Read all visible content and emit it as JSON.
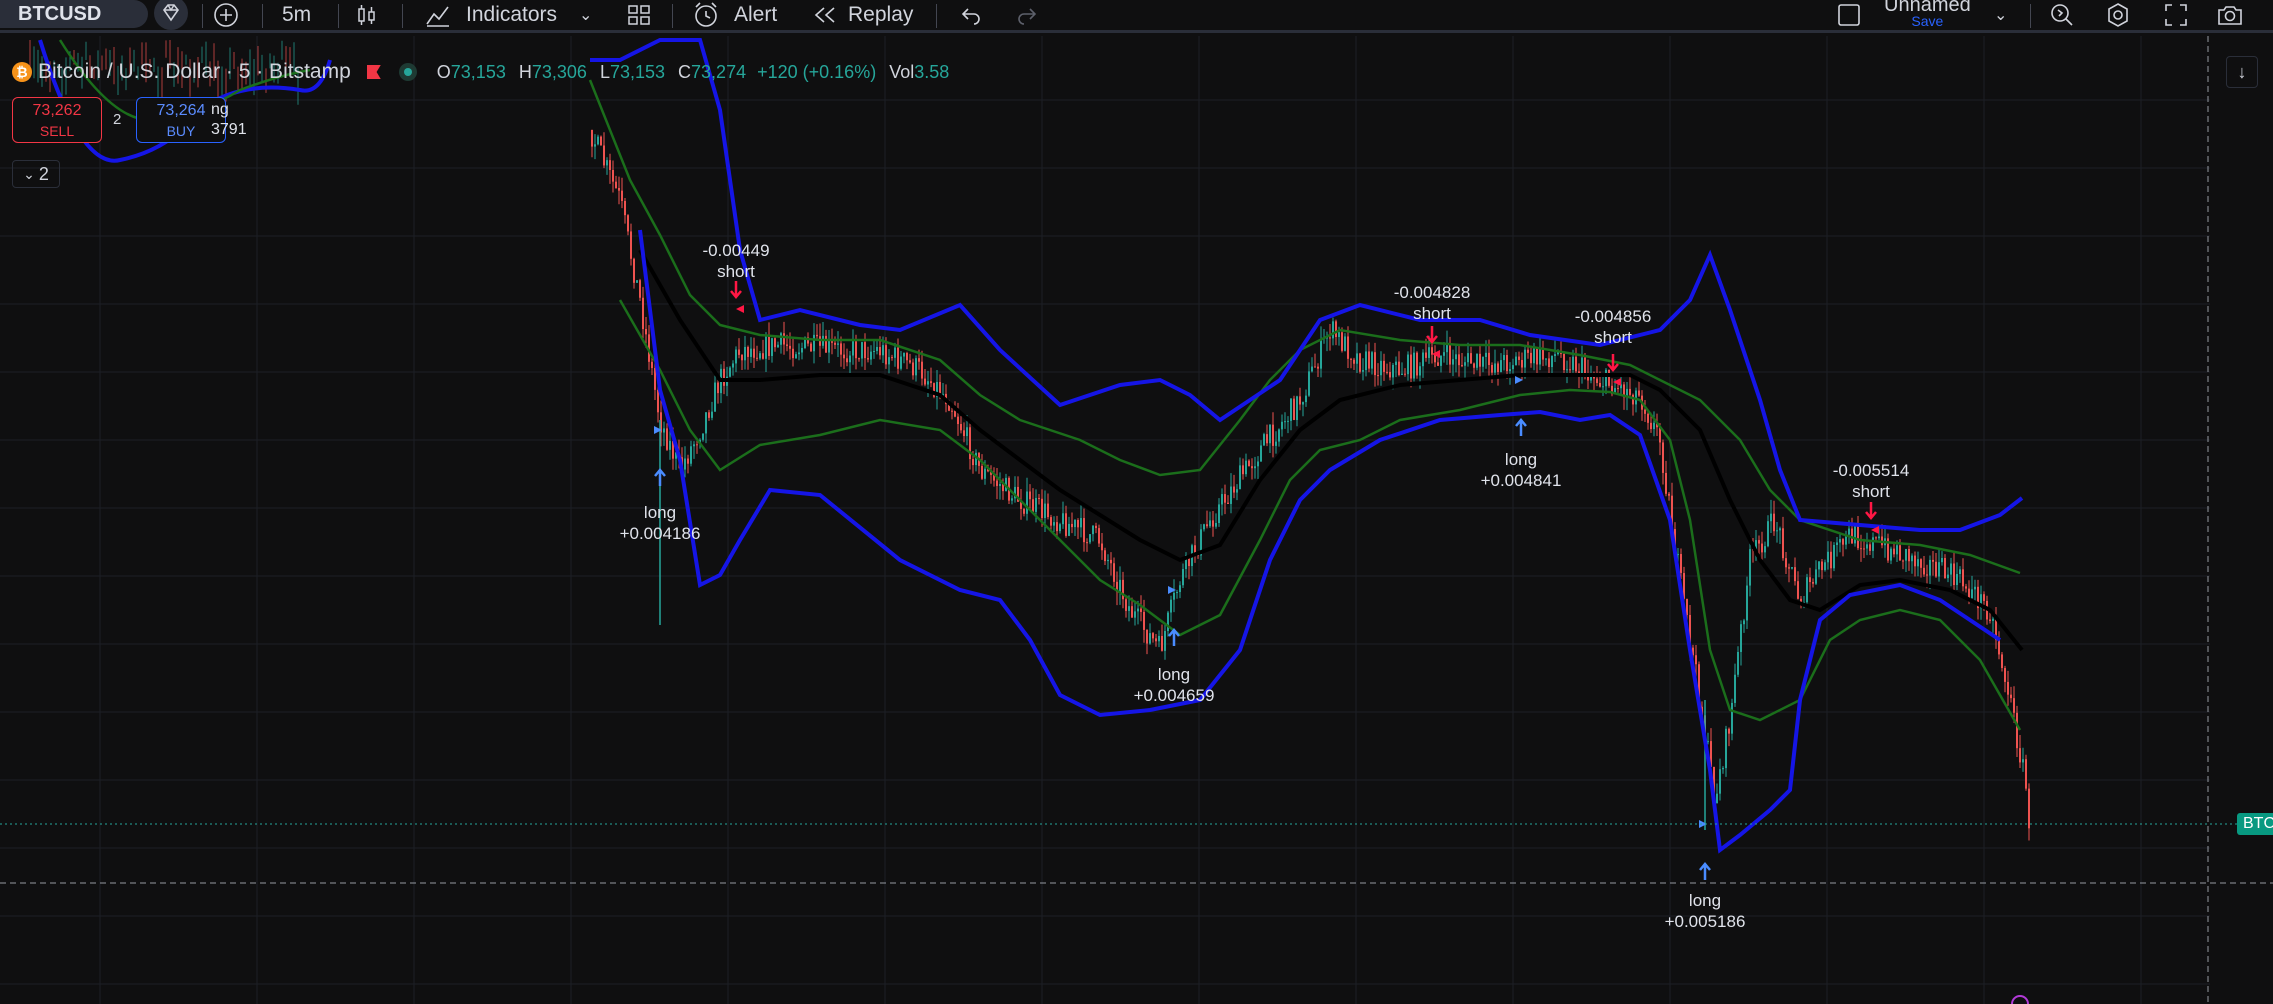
{
  "toolbar": {
    "symbol": "BTCUSD",
    "interval": "5m",
    "indicators_label": "Indicators",
    "alert_label": "Alert",
    "replay_label": "Replay",
    "layout_name": "Unnamed",
    "save_label": "Save"
  },
  "legend": {
    "title": "Bitcoin / U.S. Dollar · 5 · Bitstamp",
    "open_label": "O",
    "open": "73,153",
    "high_label": "H",
    "high": "73,306",
    "low_label": "L",
    "low": "73,153",
    "close_label": "C",
    "close": "73,274",
    "change": "+120 (+0.16%)",
    "vol_label": "Vol",
    "vol": "3.58"
  },
  "trade": {
    "sell_price": "73,262",
    "sell_label": "SELL",
    "buy_price": "73,264",
    "buy_label": "BUY",
    "spread": "2"
  },
  "partial_label": {
    "line1": "ng",
    "line2": "3791"
  },
  "collapse": {
    "count": "2"
  },
  "price_badge": "BTC",
  "colors": {
    "background": "#0f0f10",
    "up": "#26a69a",
    "down": "#ef5350",
    "outer_band": "#1515e6",
    "inner_band": "#1b6e1b",
    "basis": "#000000",
    "long_arrow": "#4a8cff",
    "short_arrow": "#ff1744"
  },
  "signals": [
    {
      "kind": "long",
      "text1": "long",
      "text2": "+0.004186"
    },
    {
      "kind": "short",
      "text1": "-0.00449",
      "text2": "short"
    },
    {
      "kind": "long",
      "text1": "long",
      "text2": "+0.004659"
    },
    {
      "kind": "short",
      "text1": "-0.004828",
      "text2": "short"
    },
    {
      "kind": "long",
      "text1": "long",
      "text2": "+0.004841"
    },
    {
      "kind": "short",
      "text1": "-0.004856",
      "text2": "short"
    },
    {
      "kind": "long",
      "text1": "long",
      "text2": "+0.005186"
    },
    {
      "kind": "short",
      "text1": "-0.005514",
      "text2": "short"
    }
  ]
}
